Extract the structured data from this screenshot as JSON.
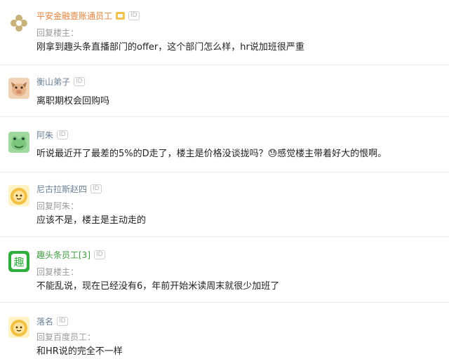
{
  "comments": [
    {
      "username": "平安金融壹账通员工",
      "badge": "ID",
      "reply_to": "回复楼主：",
      "text": "刚拿到趣头条直播部门的offer，这个部门怎么样，hr说加班很严重",
      "avatar_icon": "gold-flower-icon"
    },
    {
      "username": "衡山弟子",
      "badge": "ID",
      "reply_to": "",
      "text": "离职期权会回购吗",
      "avatar_icon": "pig-face-icon"
    },
    {
      "username": "阿朱",
      "badge": "ID",
      "reply_to": "",
      "text": "听说最近开了最差的5%的D走了，楼主是价格没谈拢吗？😓感觉楼主带着好大的恨啊。",
      "avatar_icon": "frog-face-icon"
    },
    {
      "username": "尼古拉斯赵四",
      "badge": "ID",
      "reply_to": "回复阿朱：",
      "text": "应该不是，楼主是主动走的",
      "avatar_icon": "lion-face-icon"
    },
    {
      "username": "趣头条员工[3]",
      "badge": "ID",
      "reply_to": "回复楼主：",
      "text": "不能乱说，现在已经没有6，年前开始米读周末就很少加班了",
      "avatar_icon": "qu-logo-icon",
      "avatar_char": "趣"
    },
    {
      "username": "落名",
      "badge": "ID",
      "reply_to": "回复百度员工：",
      "text": "和HR说的完全不一样",
      "avatar_icon": "lion-face-icon"
    }
  ],
  "colors": {
    "username_default": "#6b7f95",
    "username_company": "#e3813b",
    "username_qtt": "#3d9a3d",
    "reply": "#9a9a9a",
    "text": "#222222"
  }
}
